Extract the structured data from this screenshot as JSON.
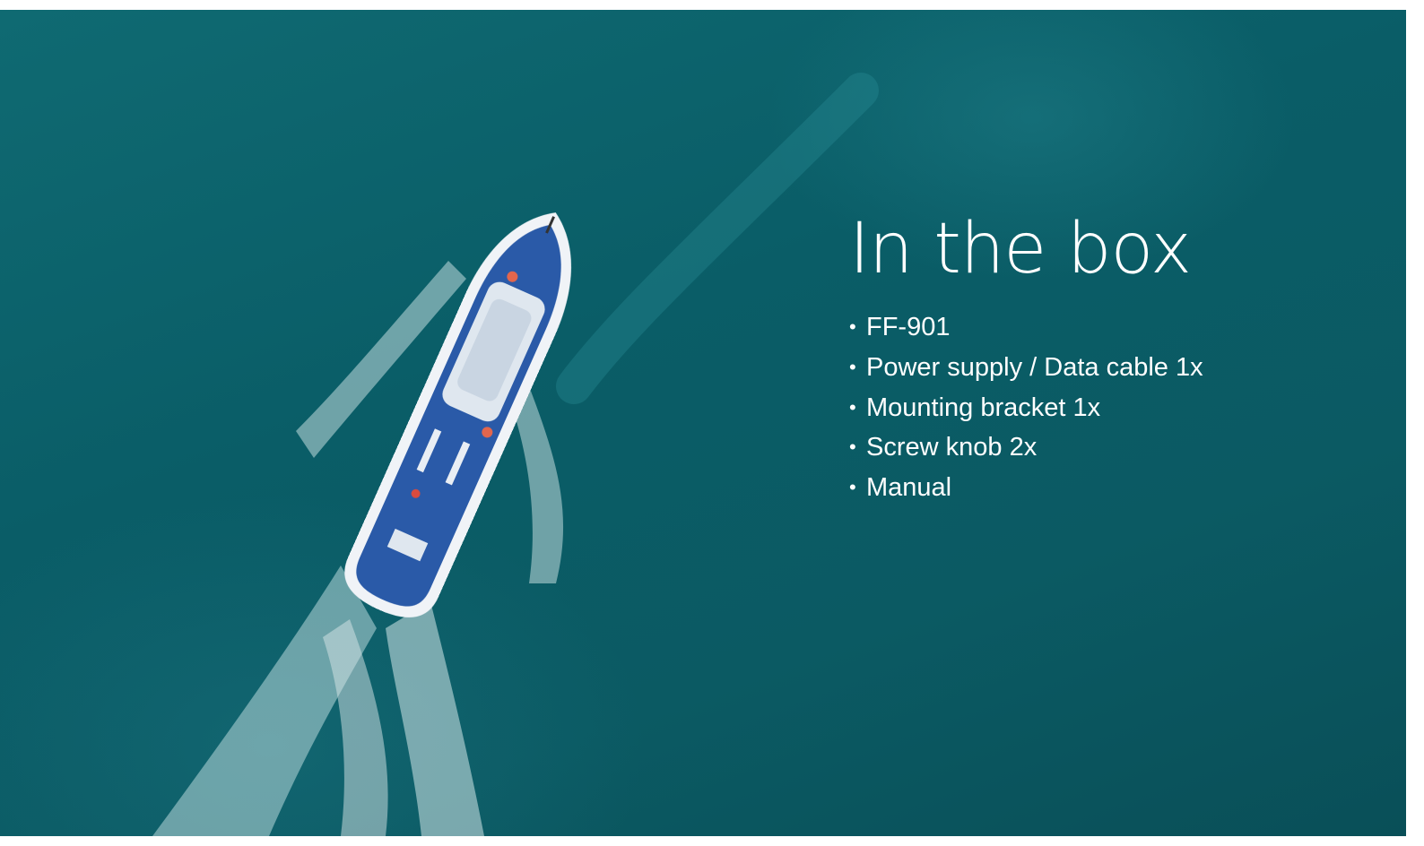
{
  "hero": {
    "title": "In the box",
    "items": [
      "FF-901",
      "Power supply / Data cable 1x",
      "Mounting bracket 1x",
      "Screw knob 2x",
      "Manual"
    ],
    "bullet": "•"
  },
  "colors": {
    "sea": "#0b5e68",
    "text": "#ffffff",
    "hull": "#2a5aa8",
    "wake": "#e8f4f4"
  }
}
